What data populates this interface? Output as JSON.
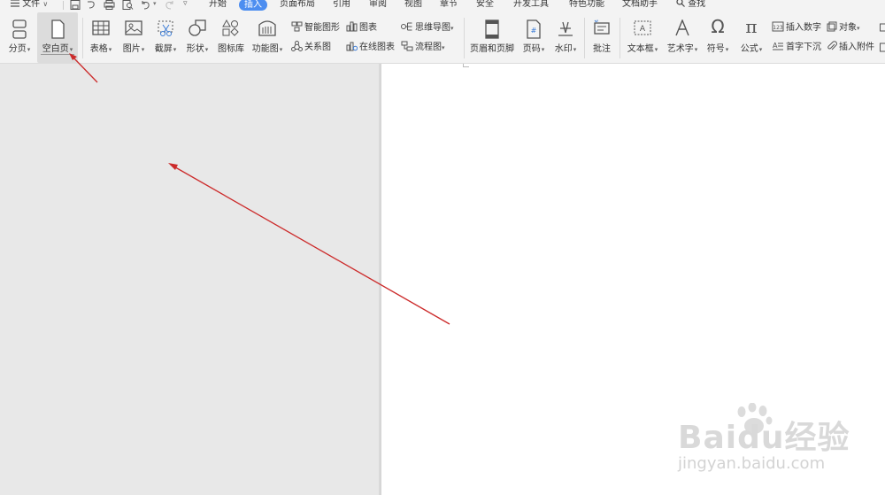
{
  "quick_access": {
    "menu_label": "文件",
    "dropdown_glyph": "∨",
    "icons": [
      "save-icon",
      "undo-history-icon",
      "print-icon",
      "print-preview-icon",
      "undo-icon",
      "redo-icon",
      "customize-toolbar-icon"
    ]
  },
  "tabs": [
    {
      "label": "开始",
      "active": false
    },
    {
      "label": "插入",
      "active": true
    },
    {
      "label": "页面布局",
      "active": false
    },
    {
      "label": "引用",
      "active": false
    },
    {
      "label": "审阅",
      "active": false
    },
    {
      "label": "视图",
      "active": false
    },
    {
      "label": "章节",
      "active": false
    },
    {
      "label": "安全",
      "active": false
    },
    {
      "label": "开发工具",
      "active": false
    },
    {
      "label": "特色功能",
      "active": false
    },
    {
      "label": "文档助手",
      "active": false
    }
  ],
  "search": {
    "label": "查找"
  },
  "ribbon": {
    "page_break": "分页",
    "blank_page": "空白页",
    "table": "表格",
    "picture": "图片",
    "screenshot": "截屏",
    "shapes": "形状",
    "icon_library": "图标库",
    "function_chart": "功能图",
    "smart_art": "智能图形",
    "relation_chart": "关系图",
    "chart": "图表",
    "online_chart": "在线图表",
    "mind_map": "思维导图",
    "flowchart": "流程图",
    "header_footer": "页眉和页脚",
    "page_number": "页码",
    "watermark": "水印",
    "comment": "批注",
    "text_box": "文本框",
    "word_art": "艺术字",
    "symbol": "符号",
    "formula": "公式",
    "insert_number": "插入数字",
    "object": "对象",
    "drop_cap": "首字下沉",
    "attachment": "插入附件",
    "dropdown_glyph": "▾"
  },
  "watermark_logo": {
    "brand": "Baidu经验",
    "url": "jingyan.baidu.com"
  },
  "colors": {
    "accent": "#4d8ef0",
    "annotation_arrow": "#cc2a2a",
    "canvas": "#e8e8e8",
    "ribbon_bg": "#f3f3f3",
    "page": "#ffffff"
  }
}
